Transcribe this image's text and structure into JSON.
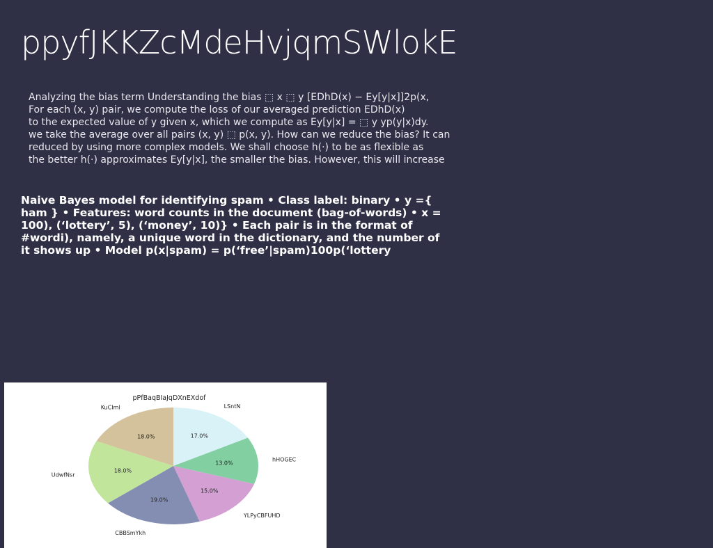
{
  "slide": {
    "title": "ppyfJKKZcMdeHvjqmSWlokE"
  },
  "bias_paragraph": {
    "lines": [
      "Analyzing the bias term Understanding the bias ⬚ x ⬚ y [EDhD(x) − Ey[y|x]]2p(x,",
      "For each (x, y) pair, we compute the loss of our averaged prediction EDhD(x)",
      "to the expected value of y given x, which we compute as Ey[y|x] = ⬚ y yp(y|x)dy.",
      "we take the average over all pairs (x, y) ⬚ p(x, y). How can we reduce the bias? It can",
      "reduced by using more complex models. We shall choose h(·) to be as flexible as",
      "the better h(·) approximates Ey[y|x], the smaller the bias. However, this will increase"
    ]
  },
  "bayes_paragraph": {
    "lines": [
      "Naive Bayes model for identifying spam • Class label: binary • y ={",
      "ham } • Features: word counts in the document (bag-of-words) • x =",
      "100), (‘lottery’, 5), (‘money’, 10)} • Each pair is in the format of",
      "#wordi), namely, a unique word in the dictionary, and the number of",
      "it shows up • Model p(x|spam) = p(‘free’|spam)100p(‘lottery"
    ]
  },
  "chart_data": {
    "type": "pie",
    "title": "pPfBaqBIaJqDXnEXdof",
    "start_angle_deg": 90,
    "direction": "clockwise",
    "slices": [
      {
        "label": "LSntN",
        "value": 17.0,
        "pct_text": "17.0%",
        "color": "#d9f2f7"
      },
      {
        "label": "hHOGEC",
        "value": 13.0,
        "pct_text": "13.0%",
        "color": "#82cfa2"
      },
      {
        "label": "YLPyCBFUHD",
        "value": 15.0,
        "pct_text": "15.0%",
        "color": "#d49fd3"
      },
      {
        "label": "CBBSmYkh",
        "value": 19.0,
        "pct_text": "19.0%",
        "color": "#848eb2"
      },
      {
        "label": "UdwfNsr",
        "value": 18.0,
        "pct_text": "18.0%",
        "color": "#c2e59c"
      },
      {
        "label": "KuCIml",
        "value": 18.0,
        "pct_text": "18.0%",
        "color": "#d3c29b"
      }
    ]
  }
}
